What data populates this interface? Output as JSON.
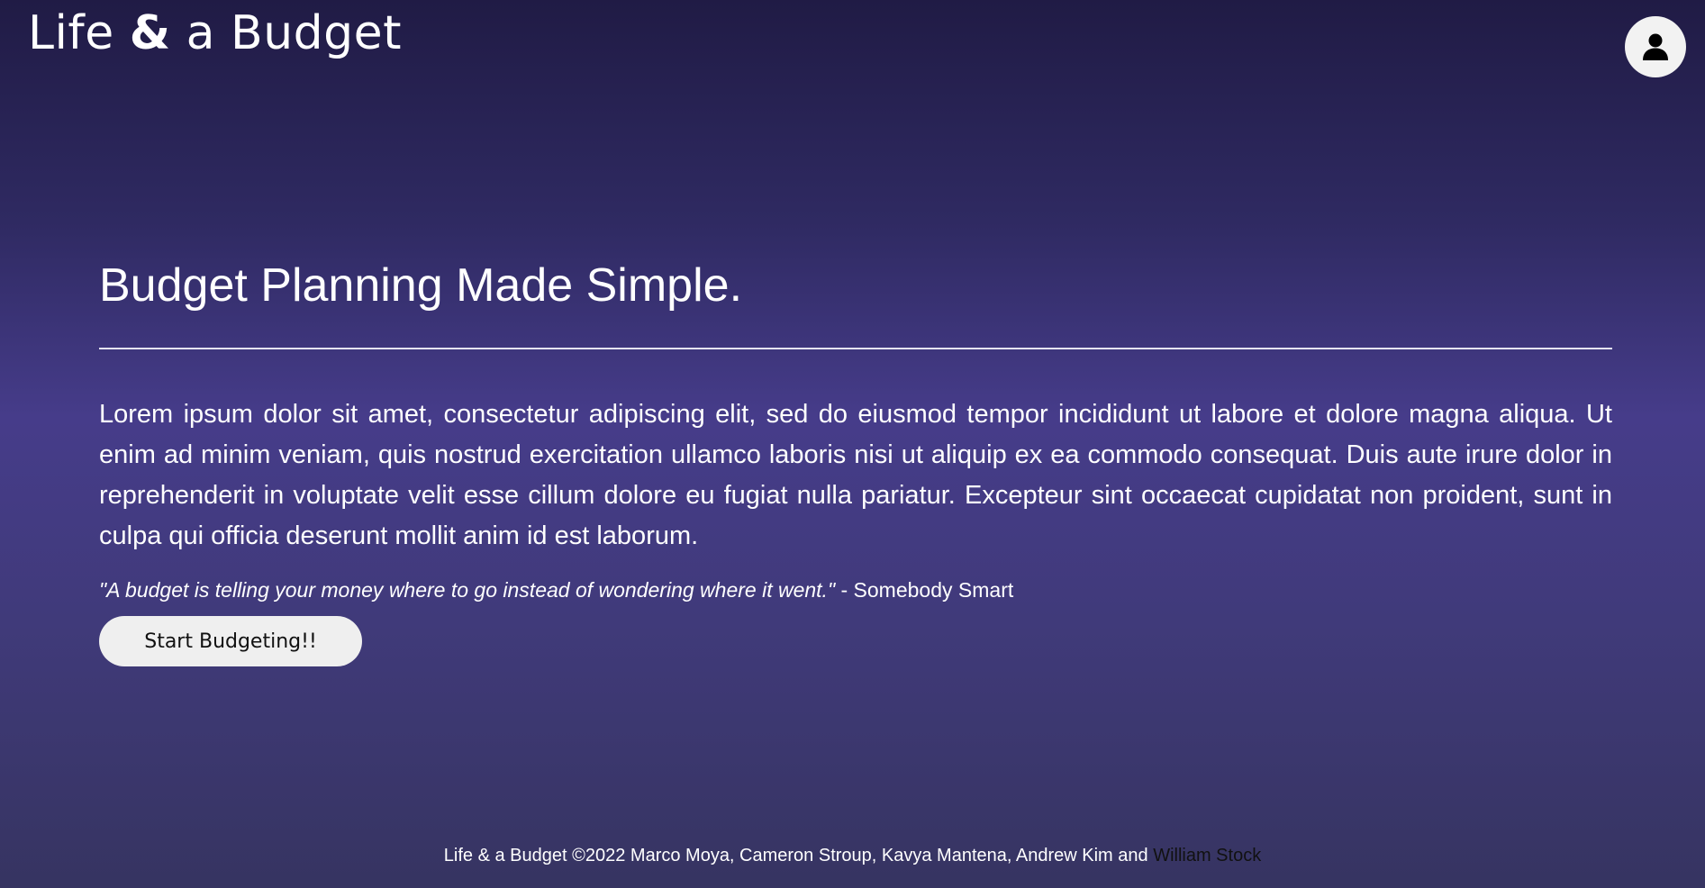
{
  "header": {
    "brand_part1": "Life ",
    "brand_amp": "&",
    "brand_part2": " a Budget",
    "account_icon": "user-icon"
  },
  "hero": {
    "headline": "Budget Planning Made Simple.",
    "body": "Lorem ipsum dolor sit amet, consectetur adipiscing elit, sed do eiusmod tempor incididunt ut labore et dolore magna aliqua. Ut enim ad minim veniam, quis nostrud exercitation ullamco laboris nisi ut aliquip ex ea commodo consequat. Duis aute irure dolor in reprehenderit in voluptate velit esse cillum dolore eu fugiat nulla pariatur. Excepteur sint occaecat cupidatat non proident, sunt in culpa qui officia deserunt mollit anim id est laborum.",
    "quote_text": "\"A budget is telling your money where to go instead of wondering where it went.\"",
    "quote_author": " - Somebody Smart",
    "cta_label": "Start Budgeting!!"
  },
  "footer": {
    "text": "Life & a Budget ©2022 Marco Moya, Cameron Stroup, Kavya Mantena, Andrew Kim and ",
    "link_text": "William Stock"
  },
  "colors": {
    "background_top": "#201b45",
    "background_mid": "#463c8a",
    "text": "#ffffff",
    "button_bg": "#efefef"
  }
}
